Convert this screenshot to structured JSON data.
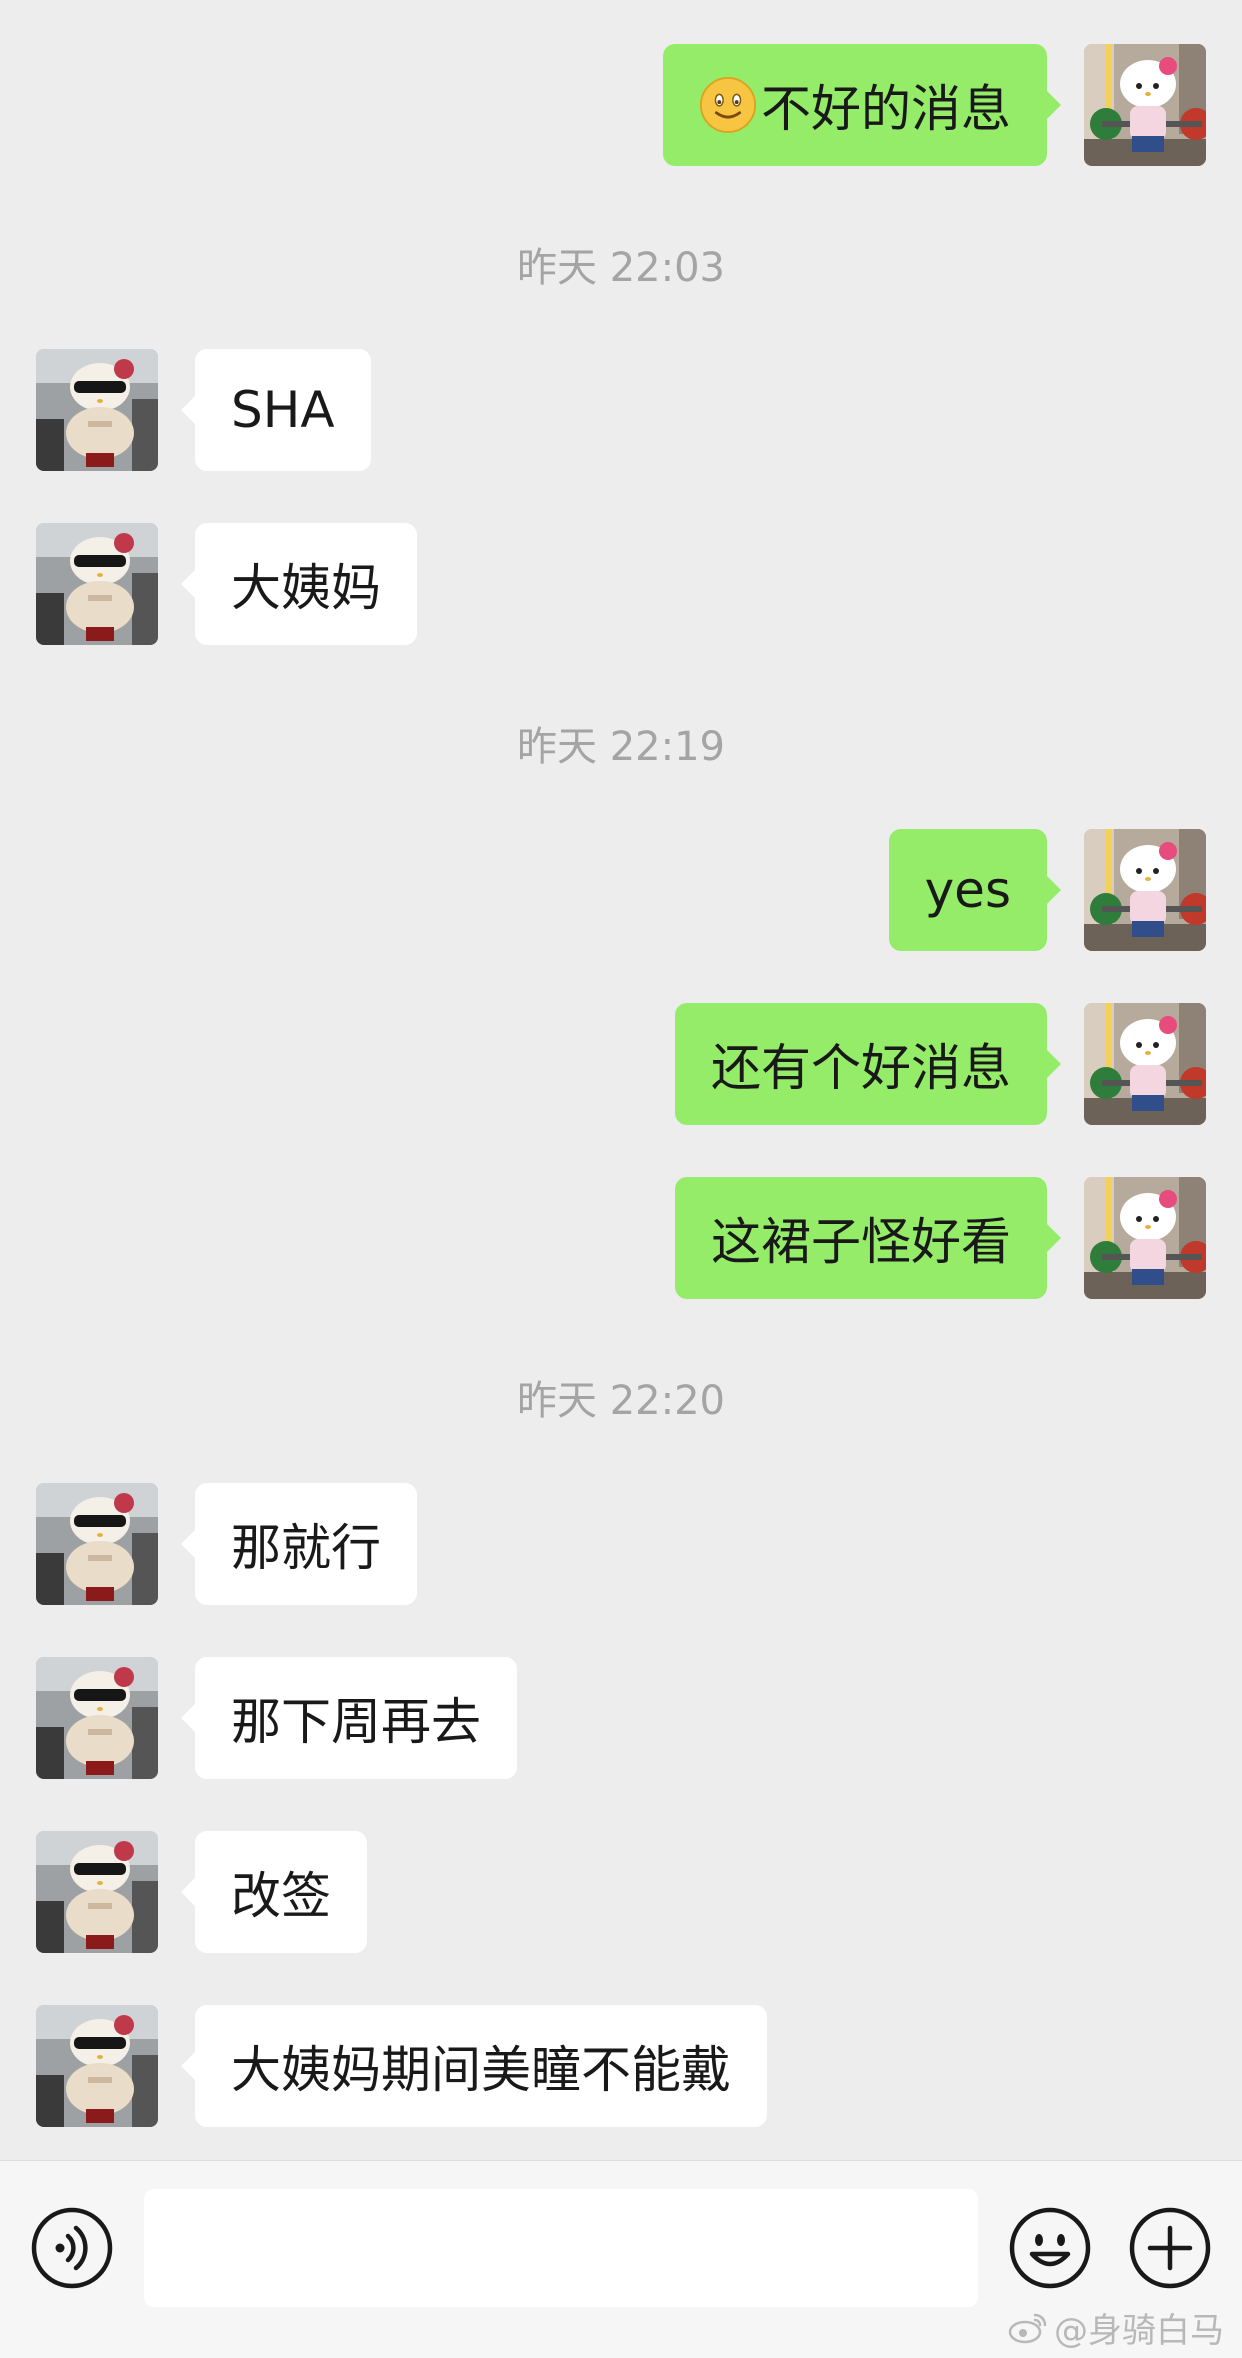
{
  "timestamps": [
    "昨天 22:03",
    "昨天 22:19",
    "昨天 22:20"
  ],
  "messages": [
    {
      "side": "right",
      "text": "不好的消息",
      "emoji": "smiley-emoji"
    },
    {
      "side": "left",
      "text": "SHA"
    },
    {
      "side": "left",
      "text": "大姨妈"
    },
    {
      "side": "right",
      "text": "yes"
    },
    {
      "side": "right",
      "text": "还有个好消息"
    },
    {
      "side": "right",
      "text": "这裙子怪好看"
    },
    {
      "side": "left",
      "text": "那就行"
    },
    {
      "side": "left",
      "text": "那下周再去"
    },
    {
      "side": "left",
      "text": "改签"
    },
    {
      "side": "left",
      "text": "大姨妈期间美瞳不能戴"
    }
  ],
  "input": {
    "placeholder": ""
  },
  "icons": {
    "voice": "voice-icon",
    "emoji": "emoji-icon",
    "plus": "plus-icon"
  },
  "watermark": {
    "text": "@身骑白马"
  },
  "colors": {
    "background": "#ededed",
    "sent_bubble": "#95ec69",
    "received_bubble": "#ffffff",
    "timestamp": "#a4a4a4"
  }
}
